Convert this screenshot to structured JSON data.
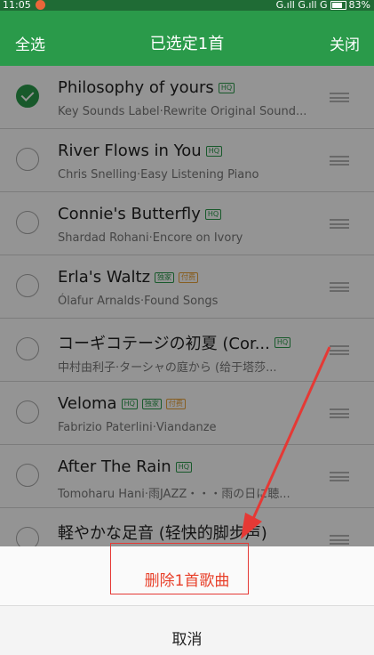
{
  "status": {
    "time": "11:05",
    "signal": "G.ıll G.ıll G",
    "battery": "83%"
  },
  "header": {
    "select_all": "全选",
    "title": "已选定1首",
    "close": "关闭"
  },
  "songs": [
    {
      "title": "Philosophy of yours",
      "subtitle": "Key Sounds Label·Rewrite Original Sound...",
      "checked": true,
      "badges": [
        "HQ"
      ]
    },
    {
      "title": "River Flows in You",
      "subtitle": "Chris Snelling·Easy Listening Piano",
      "checked": false,
      "badges": [
        "HQ"
      ]
    },
    {
      "title": "Connie's Butterfly",
      "subtitle": "Shardad Rohani·Encore on Ivory",
      "checked": false,
      "badges": [
        "HQ"
      ]
    },
    {
      "title": "Erla's Waltz",
      "subtitle": "Ólafur Arnalds·Found Songs",
      "checked": false,
      "badges": [
        "独家",
        "付费"
      ]
    },
    {
      "title": "コーギコテージの初夏 (Cor...",
      "subtitle": "中村由利子·ターシャの庭から (给于塔莎...",
      "checked": false,
      "badges": [
        "HQ"
      ]
    },
    {
      "title": "Veloma",
      "subtitle": "Fabrizio Paterlini·Viandanze",
      "checked": false,
      "badges": [
        "HQ",
        "独家",
        "付费"
      ]
    },
    {
      "title": "After The Rain",
      "subtitle": "Tomoharu Hani·雨JAZZ・・・雨の日に聴...",
      "checked": false,
      "badges": [
        "HQ"
      ]
    },
    {
      "title": "軽やかな足音 (轻快的脚步声)",
      "subtitle": "",
      "checked": false,
      "badges": []
    }
  ],
  "sheet": {
    "delete_label": "删除1首歌曲",
    "cancel_label": "取消"
  },
  "colors": {
    "green": "#2a9a4a",
    "delete_red": "#e8402a",
    "annotation_red": "#e53935"
  }
}
